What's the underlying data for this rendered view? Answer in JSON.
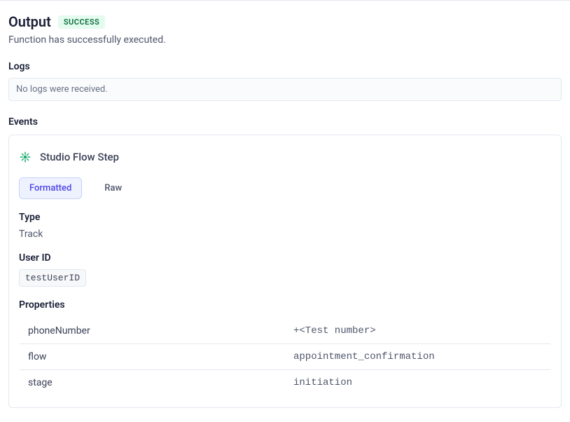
{
  "output": {
    "title": "Output",
    "badge": "SUCCESS",
    "subtitle": "Function has successfully executed."
  },
  "logs": {
    "heading": "Logs",
    "empty_message": "No logs were received."
  },
  "events": {
    "heading": "Events",
    "event_title": "Studio Flow Step",
    "tabs": {
      "formatted": "Formatted",
      "raw": "Raw"
    },
    "type": {
      "label": "Type",
      "value": "Track"
    },
    "user_id": {
      "label": "User ID",
      "value": "testUserID"
    },
    "properties": {
      "label": "Properties",
      "rows": [
        {
          "key": "phoneNumber",
          "value": "+<Test number>"
        },
        {
          "key": "flow",
          "value": "appointment_confirmation"
        },
        {
          "key": "stage",
          "value": "initiation"
        }
      ]
    }
  }
}
